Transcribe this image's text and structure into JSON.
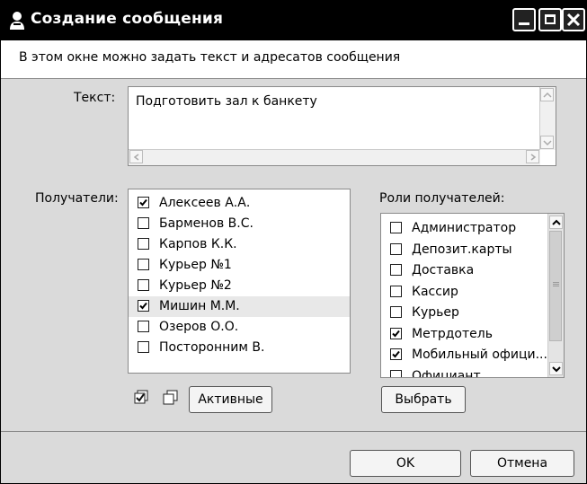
{
  "window": {
    "title": "Создание сообщения",
    "info": "В этом окне можно задать текст и адресатов сообщения"
  },
  "text_field": {
    "label": "Текст:",
    "value": "Подготовить зал к банкету"
  },
  "recipients": {
    "label": "Получатели:",
    "items": [
      {
        "name": "Алексеев А.А.",
        "checked": true
      },
      {
        "name": "Барменов В.С.",
        "checked": false
      },
      {
        "name": "Карпов К.К.",
        "checked": false
      },
      {
        "name": "Курьер №1",
        "checked": false
      },
      {
        "name": "Курьер №2",
        "checked": false
      },
      {
        "name": "Мишин М.М.",
        "checked": true
      },
      {
        "name": "Озеров О.О.",
        "checked": false
      },
      {
        "name": "Посторонним В.",
        "checked": false
      }
    ],
    "active_button": "Активные"
  },
  "roles": {
    "label": "Роли получателей:",
    "items": [
      {
        "name": "Администратор",
        "checked": false
      },
      {
        "name": "Депозит.карты",
        "checked": false
      },
      {
        "name": "Доставка",
        "checked": false
      },
      {
        "name": "Кассир",
        "checked": false
      },
      {
        "name": "Курьер",
        "checked": false
      },
      {
        "name": "Метрдотель",
        "checked": true
      },
      {
        "name": "Мобильный офици...",
        "checked": true
      },
      {
        "name": "Официант",
        "checked": false
      }
    ],
    "select_button": "Выбрать"
  },
  "footer": {
    "ok": "OK",
    "cancel": "Отмена"
  }
}
